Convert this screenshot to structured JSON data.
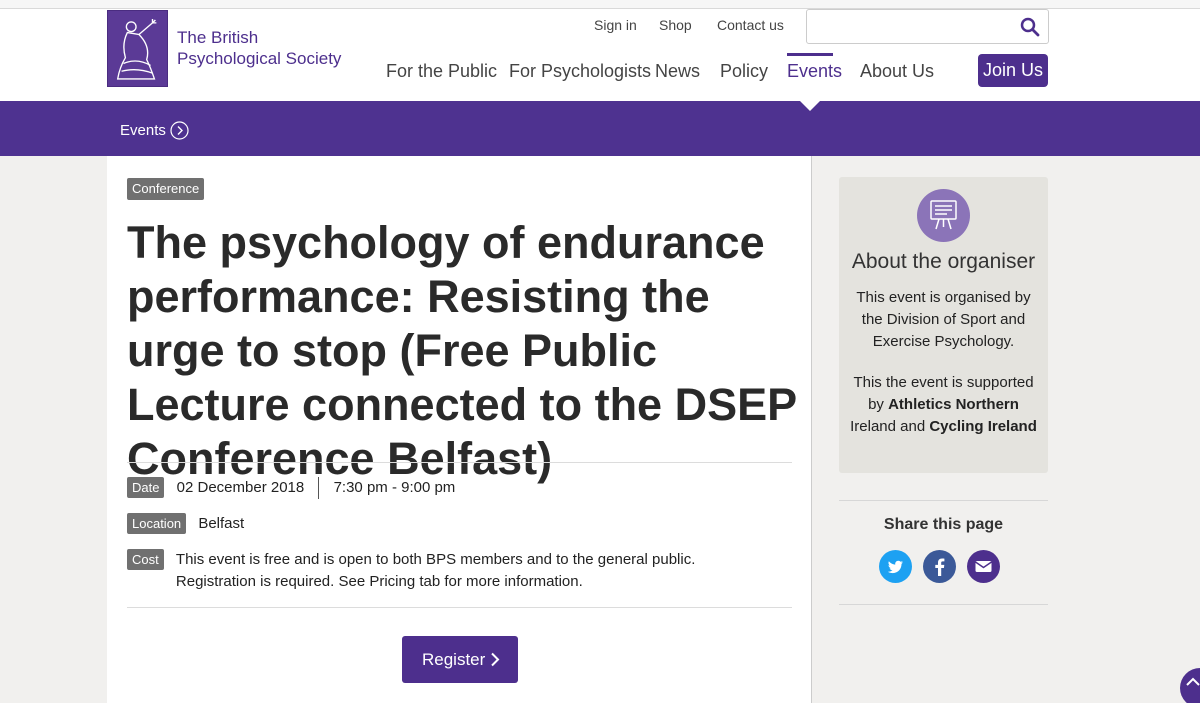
{
  "brand": {
    "line1": "The British",
    "line2": "Psychological Society"
  },
  "utility_nav": {
    "sign_in": "Sign in",
    "shop": "Shop",
    "contact": "Contact us"
  },
  "search": {
    "placeholder": ""
  },
  "main_nav": {
    "for_public": "For the Public",
    "for_psychologists": "For Psychologists",
    "news": "News",
    "policy": "Policy",
    "events": "Events",
    "about": "About Us"
  },
  "join_label": "Join Us",
  "breadcrumb": {
    "label": "Events"
  },
  "event": {
    "category": "Conference",
    "title": "The psychology of endurance performance: Resisting the urge to stop (Free Public Lecture connected to the DSEP Conference Belfast)",
    "date_label": "Date",
    "date": "02 December 2018",
    "time": "7:30 pm - 9:00 pm",
    "location_label": "Location",
    "location": "Belfast",
    "cost_label": "Cost",
    "cost_line1": "This event is free and is open to both BPS members and to the general public.",
    "cost_line2": "Registration is required. See Pricing tab for more information.",
    "register_label": "Register"
  },
  "organiser": {
    "title": "About the organiser",
    "text": "This event is organised by the Division of Sport and Exercise Psychology.",
    "support_prefix": "This the event is supported by ",
    "support_org1": "Athletics Northern",
    "support_mid": " Ireland and ",
    "support_org2": "Cycling Ireland"
  },
  "share": {
    "title": "Share this page"
  },
  "colors": {
    "brand_purple": "#4d2f8d",
    "twitter": "#1da1f2",
    "facebook": "#3b5998",
    "email": "#4d2f8d",
    "tag_grey": "#707070"
  },
  "icons": [
    "search-icon",
    "chevron-right-circle-icon",
    "chevron-right-icon",
    "noticeboard-icon",
    "twitter-icon",
    "facebook-icon",
    "email-icon"
  ]
}
